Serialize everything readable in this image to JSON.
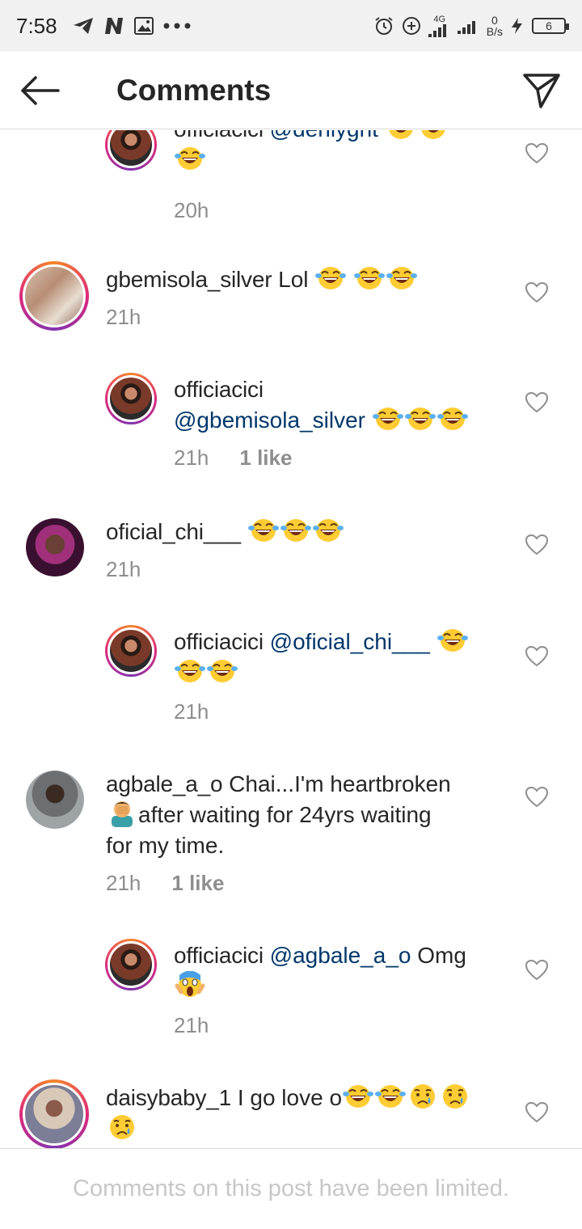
{
  "status_bar": {
    "time": "7:58",
    "network": "4G",
    "net_speed_value": "0",
    "net_speed_unit": "B/s",
    "battery": "6"
  },
  "header": {
    "title": "Comments"
  },
  "comments": [
    {
      "username": "officiacici",
      "mention": "@dehlyght",
      "text": "",
      "emoji_line1": [
        "laugh",
        "laugh"
      ],
      "emoji_line2": [
        "laugh"
      ],
      "time": "20h",
      "likes": "",
      "reply": true
    },
    {
      "username": "gbemisola_silver",
      "mention": "",
      "text": "Lol",
      "emoji_line1": [
        "laugh",
        "laugh",
        "laugh"
      ],
      "time": "21h",
      "likes": "",
      "reply": false
    },
    {
      "username": "officiacici",
      "mention": "@gbemisola_silver",
      "text": "",
      "emoji_line1": [
        "laugh",
        "laugh",
        "laugh"
      ],
      "time": "21h",
      "likes": "1 like",
      "reply": true
    },
    {
      "username": "oficial_chi___",
      "mention": "",
      "text": "",
      "emoji_line1": [
        "laugh",
        "laugh",
        "laugh"
      ],
      "time": "21h",
      "likes": "",
      "reply": false
    },
    {
      "username": "officiacici",
      "mention": "@oficial_chi___",
      "text": "",
      "emoji_line1": [
        "laugh"
      ],
      "emoji_line2": [
        "laugh",
        "laugh"
      ],
      "time": "21h",
      "likes": "",
      "reply": true
    },
    {
      "username": "agbale_a_o",
      "mention": "",
      "text_line1": "Chai...I'm heartbroken",
      "text_line2": "after waiting for 24yrs waiting",
      "text_line3": "for my time.",
      "emoji_inline": [
        "facepalm"
      ],
      "time": "21h",
      "likes": "1 like",
      "reply": false
    },
    {
      "username": "officiacici",
      "mention": "@agbale_a_o",
      "text": "Omg",
      "emoji_line2": [
        "scream"
      ],
      "time": "21h",
      "likes": "",
      "reply": true
    },
    {
      "username": "daisybaby_1",
      "mention": "",
      "text": "I go love o",
      "emoji_line1": [
        "laugh",
        "laugh",
        "sad",
        "sad"
      ],
      "emoji_line2": [
        "sad"
      ],
      "time": "",
      "likes": "",
      "reply": false
    }
  ],
  "footer": {
    "text": "Comments on this post have been limited."
  },
  "icons": {
    "back": "arrow-left-icon",
    "send": "paper-plane-icon",
    "like": "heart-outline-icon"
  }
}
